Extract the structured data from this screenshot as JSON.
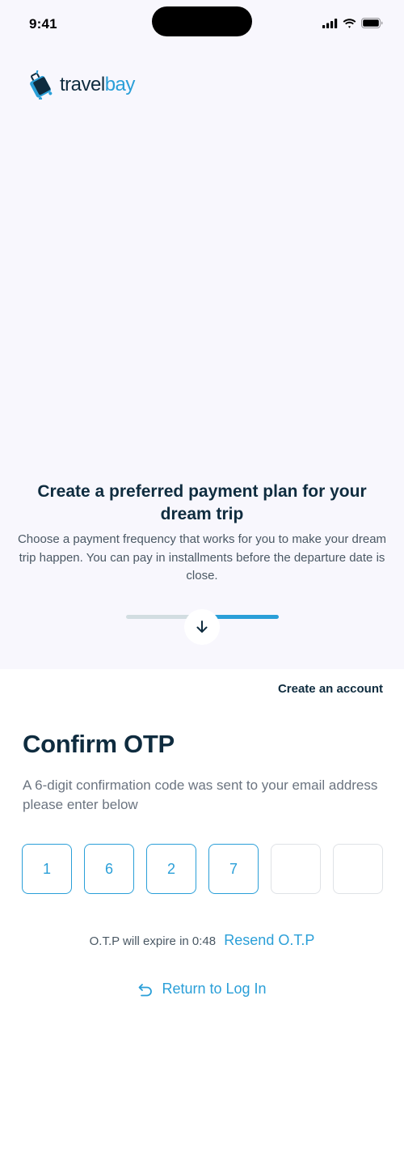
{
  "status_bar": {
    "time": "9:41"
  },
  "brand": {
    "name_prefix": "travel",
    "name_suffix": "bay",
    "accent_color": "#2a9fd8",
    "dark_color": "#0f2c3f"
  },
  "hero": {
    "title": "Create a preferred payment plan for your dream trip",
    "subtitle": "Choose a payment frequency that works for you to make your dream trip happen. You can pay in installments before the departure date is close.",
    "carousel": {
      "pages": 2,
      "active_page": 2
    }
  },
  "header_links": {
    "create_account": "Create an account"
  },
  "otp_form": {
    "title": "Confirm OTP",
    "description": "A 6-digit confirmation code was sent to your email address please enter below",
    "digits": [
      "1",
      "6",
      "2",
      "7",
      "",
      ""
    ],
    "expire_text": "O.T.P will expire in 0:48",
    "resend_label": "Resend O.T.P",
    "return_label": "Return to Log In"
  },
  "icons": {
    "logo": "suitcase-icon",
    "signal": "signal-icon",
    "wifi": "wifi-icon",
    "battery": "battery-icon",
    "scroll": "arrow-down-icon",
    "return": "undo-arrow-icon"
  }
}
